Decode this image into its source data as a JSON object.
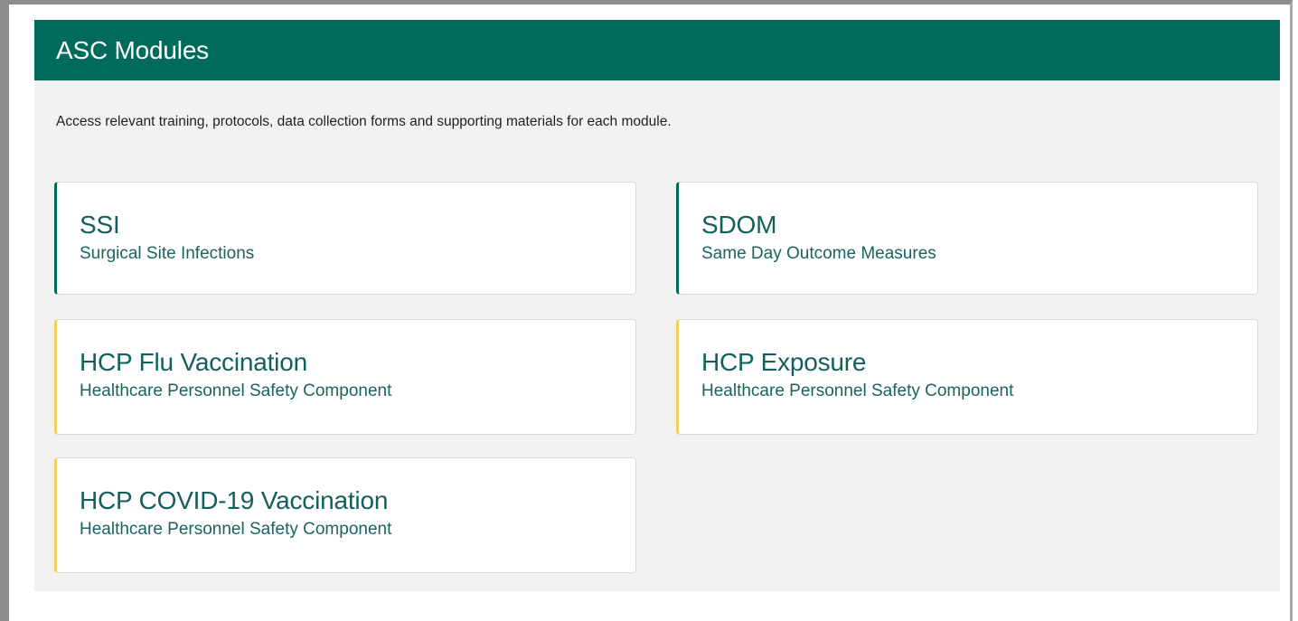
{
  "panel": {
    "title": "ASC Modules",
    "description": "Access relevant training, protocols, data collection forms and supporting materials for each module.",
    "header_color": "#006a5b",
    "accent_green": "#006a5b",
    "accent_yellow": "#f2d15a"
  },
  "modules": [
    {
      "title": "SSI",
      "subtitle": "Surgical Site Infections",
      "accent": "green"
    },
    {
      "title": "SDOM",
      "subtitle": "Same Day Outcome Measures",
      "accent": "green"
    },
    {
      "title": "HCP Flu Vaccination",
      "subtitle": "Healthcare Personnel Safety Component",
      "accent": "yellow"
    },
    {
      "title": "HCP Exposure",
      "subtitle": "Healthcare Personnel Safety Component",
      "accent": "yellow"
    },
    {
      "title": "HCP COVID-19 Vaccination",
      "subtitle": "Healthcare Personnel Safety Component",
      "accent": "yellow"
    }
  ]
}
